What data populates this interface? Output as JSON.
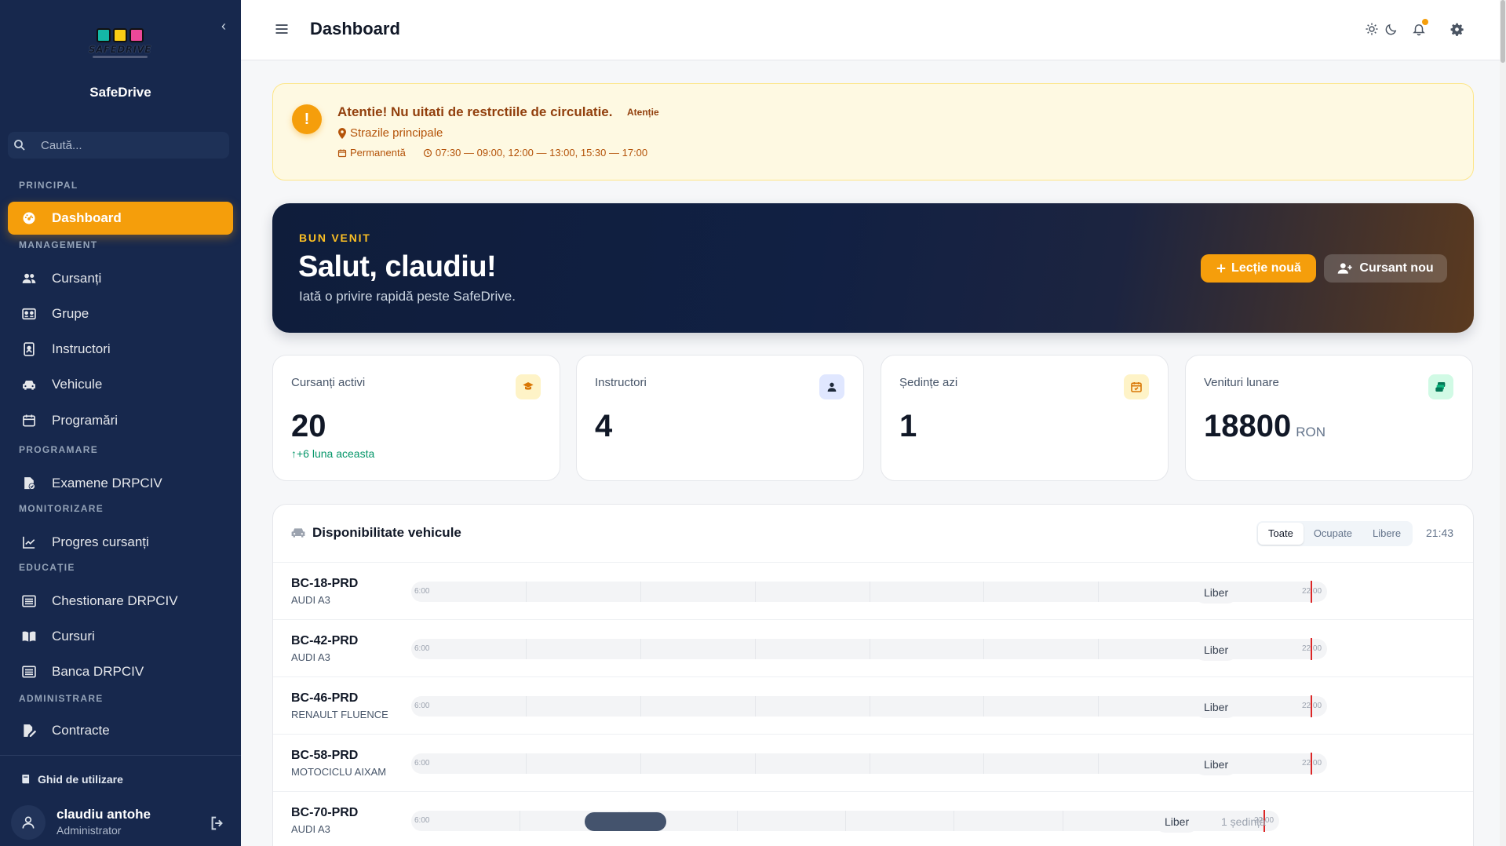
{
  "sidebar": {
    "logo_text": "SAFEDRIVE",
    "app_name": "SafeDrive",
    "search_placeholder": "Caută...",
    "sections": {
      "principal": "PRINCIPAL",
      "management": "MANAGEMENT",
      "programare": "PROGRAMARE",
      "monitorizare": "MONITORIZARE",
      "educatie": "EDUCAȚIE",
      "administrare": "ADMINISTRARE"
    },
    "items": {
      "dashboard": "Dashboard",
      "cursanti": "Cursanți",
      "grupe": "Grupe",
      "instructori": "Instructori",
      "vehicule": "Vehicule",
      "programari": "Programări",
      "examene": "Examene DRPCIV",
      "progres": "Progres cursanți",
      "chestionare": "Chestionare DRPCIV",
      "cursuri": "Cursuri",
      "banca": "Banca DRPCIV",
      "contracte": "Contracte"
    },
    "guide": "Ghid de utilizare",
    "user": {
      "name": "claudiu antohe",
      "role": "Administrator"
    }
  },
  "topbar": {
    "title": "Dashboard"
  },
  "alert": {
    "title": "Atentie! Nu uitati de restrctiile de circulatie.",
    "tag": "Atenție",
    "location": "Strazile principale",
    "recurrence": "Permanentă",
    "hours": "07:30 — 09:00, 12:00 — 13:00, 15:30 — 17:00"
  },
  "hero": {
    "kicker": "BUN VENIT",
    "title": "Salut, claudiu!",
    "subtitle": "Iată o privire rapidă peste SafeDrive.",
    "primary_button": "Lecție nouă",
    "secondary_button": "Cursant nou"
  },
  "stats": [
    {
      "label": "Cursanți activi",
      "value": "20",
      "unit": "",
      "trend": "+6 luna aceasta",
      "icon": "graduation-icon",
      "color": "#fef3c7"
    },
    {
      "label": "Instructori",
      "value": "4",
      "unit": "",
      "trend": "",
      "icon": "person-icon",
      "color": "#e0e7ff"
    },
    {
      "label": "Ședințe azi",
      "value": "1",
      "unit": "",
      "trend": "",
      "icon": "calendar-icon",
      "color": "#fef3c7"
    },
    {
      "label": "Venituri lunare",
      "value": "18800",
      "unit": "RON",
      "trend": "",
      "icon": "money-icon",
      "color": "#d1fae5"
    }
  ],
  "vehicles": {
    "title": "Disponibilitate vehicule",
    "filters": [
      "Toate",
      "Ocupate",
      "Libere"
    ],
    "active_filter": "Toate",
    "clock": "21:43",
    "timeline_start": "6:00",
    "timeline_end": "22:00",
    "rows": [
      {
        "plate": "BC-18-PRD",
        "model": "AUDI A3",
        "status": "Liber",
        "sessions": "",
        "bookings": []
      },
      {
        "plate": "BC-42-PRD",
        "model": "AUDI A3",
        "status": "Liber",
        "sessions": "",
        "bookings": []
      },
      {
        "plate": "BC-46-PRD",
        "model": "RENAULT FLUENCE",
        "status": "Liber",
        "sessions": "",
        "bookings": []
      },
      {
        "plate": "BC-58-PRD",
        "model": "MOTOCICLU AIXAM",
        "status": "Liber",
        "sessions": "",
        "bookings": []
      },
      {
        "plate": "BC-70-PRD",
        "model": "AUDI A3",
        "status": "Liber",
        "sessions": "1 ședință",
        "bookings": [
          {
            "start": 9.2,
            "end": 10.7
          }
        ]
      }
    ]
  }
}
